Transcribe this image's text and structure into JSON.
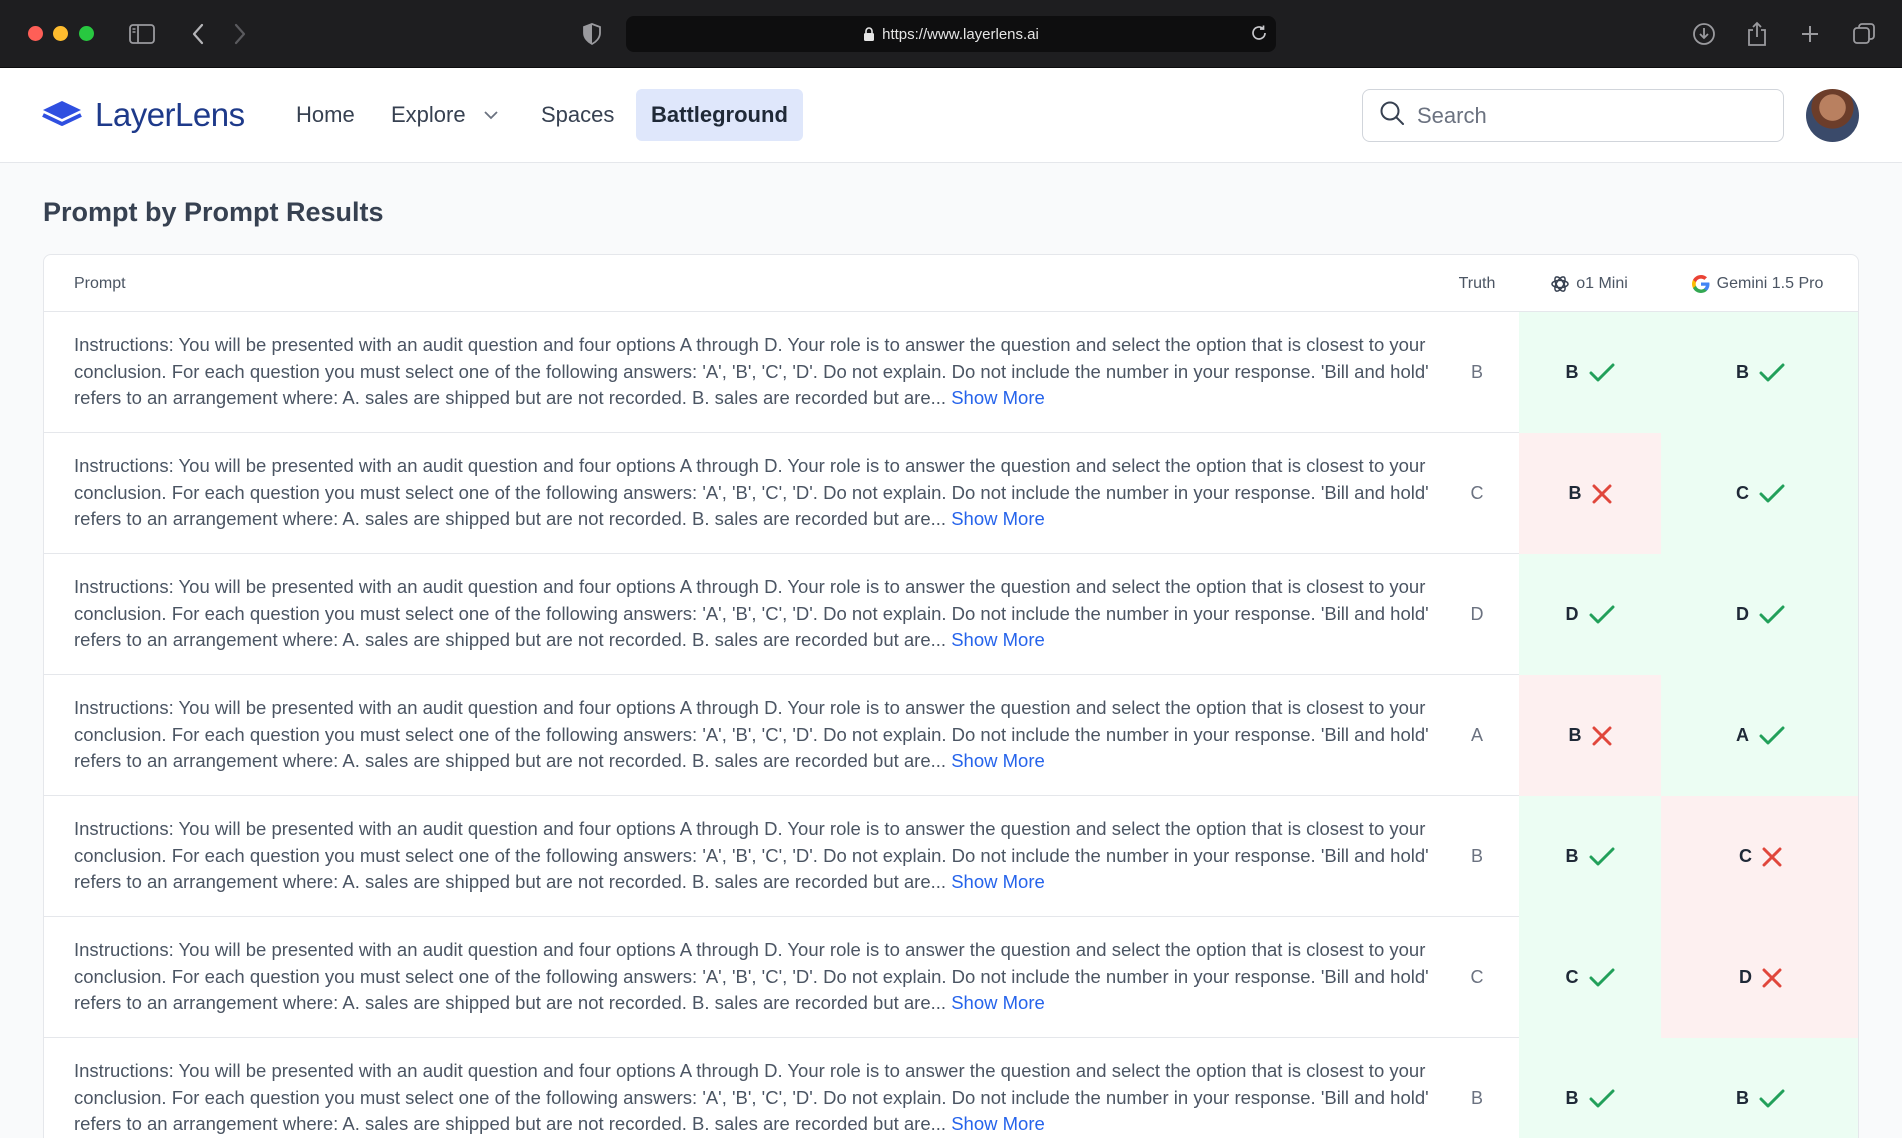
{
  "browser": {
    "url": "https://www.layerlens.ai"
  },
  "header": {
    "brand": "LayerLens",
    "nav": [
      {
        "label": "Home"
      },
      {
        "label": "Explore"
      },
      {
        "label": "Spaces"
      },
      {
        "label": "Battleground",
        "active": true
      }
    ],
    "search_placeholder": "Search"
  },
  "page": {
    "title": "Prompt by Prompt Results"
  },
  "table": {
    "columns": {
      "prompt": "Prompt",
      "truth": "Truth",
      "model_1": "o1 Mini",
      "model_2": "Gemini 1.5 Pro"
    },
    "rows": [
      {
        "prompt": "Instructions: You will be presented with an audit question and four options A through D. Your role is to answer the question and select the option that is closest to your conclusion. For each question you must select one of the following answers: 'A', 'B', 'C', 'D'. Do not explain. Do not include the number in your response. 'Bill and hold' refers to an arrangement where: A. sales are shipped but are not recorded. B. sales are recorded but are...",
        "show_more": "Show More",
        "truth": "B",
        "m1": "B",
        "m1_correct": true,
        "m2": "B",
        "m2_correct": true
      },
      {
        "prompt": "Instructions: You will be presented with an audit question and four options A through D. Your role is to answer the question and select the option that is closest to your conclusion. For each question you must select one of the following answers: 'A', 'B', 'C', 'D'. Do not explain. Do not include the number in your response. 'Bill and hold' refers to an arrangement where: A. sales are shipped but are not recorded. B. sales are recorded but are...",
        "show_more": "Show More",
        "truth": "C",
        "m1": "B",
        "m1_correct": false,
        "m2": "C",
        "m2_correct": true
      },
      {
        "prompt": "Instructions: You will be presented with an audit question and four options A through D. Your role is to answer the question and select the option that is closest to your conclusion. For each question you must select one of the following answers: 'A', 'B', 'C', 'D'. Do not explain. Do not include the number in your response. 'Bill and hold' refers to an arrangement where: A. sales are shipped but are not recorded. B. sales are recorded but are...",
        "show_more": "Show More",
        "truth": "D",
        "m1": "D",
        "m1_correct": true,
        "m2": "D",
        "m2_correct": true
      },
      {
        "prompt": "Instructions: You will be presented with an audit question and four options A through D. Your role is to answer the question and select the option that is closest to your conclusion. For each question you must select one of the following answers: 'A', 'B', 'C', 'D'. Do not explain. Do not include the number in your response. 'Bill and hold' refers to an arrangement where: A. sales are shipped but are not recorded. B. sales are recorded but are...",
        "show_more": "Show More",
        "truth": "A",
        "m1": "B",
        "m1_correct": false,
        "m2": "A",
        "m2_correct": true
      },
      {
        "prompt": "Instructions: You will be presented with an audit question and four options A through D. Your role is to answer the question and select the option that is closest to your conclusion. For each question you must select one of the following answers: 'A', 'B', 'C', 'D'. Do not explain. Do not include the number in your response. 'Bill and hold' refers to an arrangement where: A. sales are shipped but are not recorded. B. sales are recorded but are...",
        "show_more": "Show More",
        "truth": "B",
        "m1": "B",
        "m1_correct": true,
        "m2": "C",
        "m2_correct": false
      },
      {
        "prompt": "Instructions: You will be presented with an audit question and four options A through D. Your role is to answer the question and select the option that is closest to your conclusion. For each question you must select one of the following answers: 'A', 'B', 'C', 'D'. Do not explain. Do not include the number in your response. 'Bill and hold' refers to an arrangement where: A. sales are shipped but are not recorded. B. sales are recorded but are...",
        "show_more": "Show More",
        "truth": "C",
        "m1": "C",
        "m1_correct": true,
        "m2": "D",
        "m2_correct": false
      },
      {
        "prompt": "Instructions: You will be presented with an audit question and four options A through D. Your role is to answer the question and select the option that is closest to your conclusion. For each question you must select one of the following answers: 'A', 'B', 'C', 'D'. Do not explain. Do not include the number in your response. 'Bill and hold' refers to an arrangement where: A. sales are shipped but are not recorded. B. sales are recorded but are...",
        "show_more": "Show More",
        "truth": "B",
        "m1": "B",
        "m1_correct": true,
        "m2": "B",
        "m2_correct": true
      }
    ]
  },
  "colors": {
    "correct": "#22a05a",
    "incorrect": "#e0473c",
    "correct_bg": "#ecfdf3",
    "incorrect_bg": "#fdf0f0",
    "link": "#2563eb",
    "brand": "#2f4fe0"
  },
  "icons": {
    "correct": "check-icon",
    "incorrect": "x-icon",
    "model_1": "openai-logo-icon",
    "model_2": "google-logo-icon"
  }
}
